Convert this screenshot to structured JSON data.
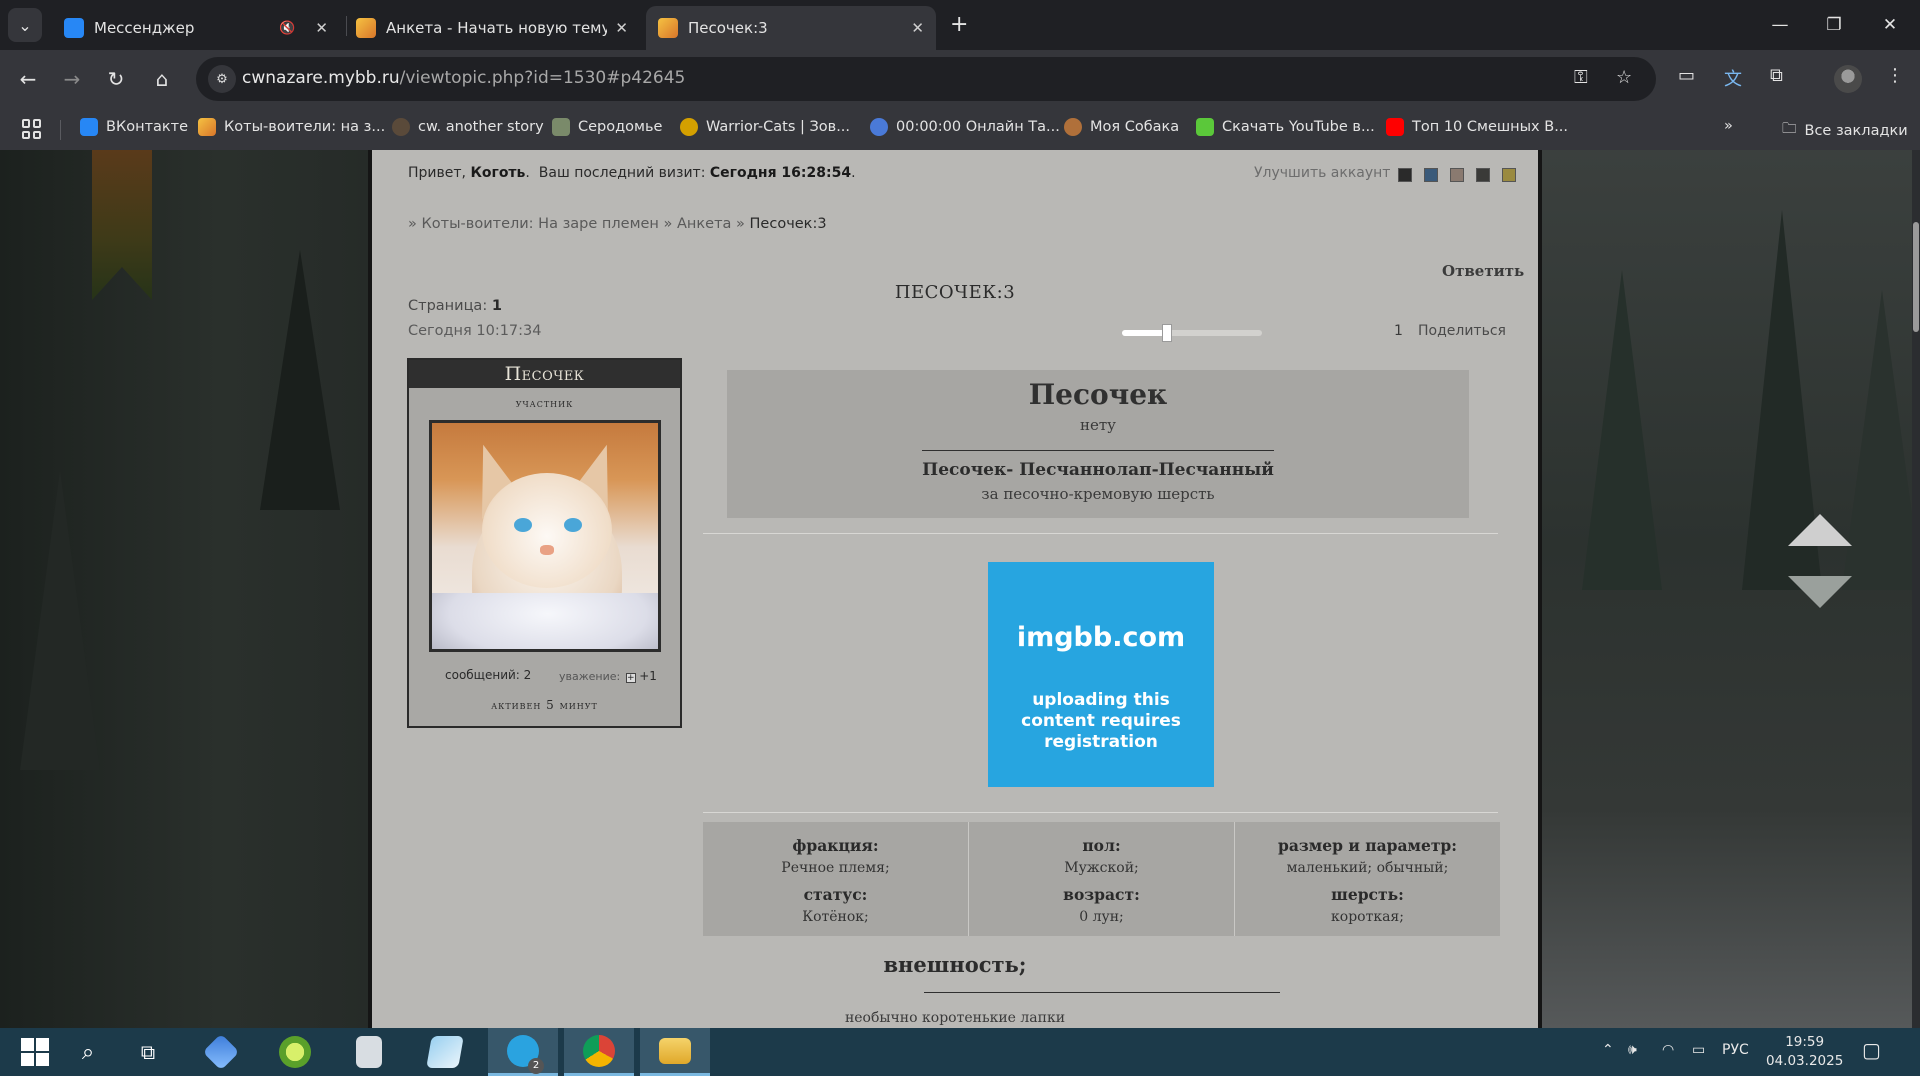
{
  "browser": {
    "tabs": [
      {
        "label": "Мессенджер",
        "active": false,
        "muted": true,
        "favicon_color": "#2787f5"
      },
      {
        "label": "Анкета - Начать новую тему",
        "active": false,
        "muted": false,
        "favicon_color": "#e8a42a"
      },
      {
        "label": "Песочек:3",
        "active": true,
        "muted": false,
        "favicon_color": "#e8a42a"
      }
    ],
    "url_host": "cwnazare.mybb.ru",
    "url_path": "/viewtopic.php?id=1530#p42645",
    "bookmarks": [
      {
        "label": "ВКонтакте",
        "color": "#2787f5"
      },
      {
        "label": "Коты-воители: на з...",
        "color": "#e8a42a"
      },
      {
        "label": "cw. another story",
        "color": "#5a4a3a"
      },
      {
        "label": "Серодомье",
        "color": "#7a8a6a"
      },
      {
        "label": "Warrior-Cats | Зов...",
        "color": "#d4a000"
      },
      {
        "label": "00:00:00 Онлайн Та...",
        "color": "#4a7ad8"
      },
      {
        "label": "Моя Собака",
        "color": "#b0703a"
      },
      {
        "label": "Скачать YouTube в...",
        "color": "#5bc83a"
      },
      {
        "label": "Топ 10 Смешных В...",
        "color": "#ff0000"
      }
    ],
    "all_bookmarks": "Все закладки"
  },
  "forum": {
    "greeting_prefix": "Привет,",
    "username": "Коготь",
    "last_visit_label": "Ваш последний визит:",
    "last_visit_value": "Сегодня 16:28:54",
    "upgrade": "Улучшить аккаунт",
    "style_swatches": [
      "#2a2a2a",
      "#3a5a7a",
      "#8a7a70",
      "#3a3a38",
      "#9a8a40"
    ],
    "breadcrumb": {
      "sep": "»",
      "forum": "Коты-воители: На заре племен",
      "section": "Анкета",
      "current": "Песочек:3"
    },
    "reply": "Ответить",
    "topic_title": "ПЕСОЧЕК:3",
    "pages_label": "Страница:",
    "pages_value": "1",
    "post_date": "Сегодня 10:17:34",
    "slider_level": 0.32,
    "post_number": "1",
    "share": "Поделиться"
  },
  "profile": {
    "name": "Песочек",
    "rank": "участник",
    "posts": "сообщений: 2",
    "respect_label": "уважение:",
    "respect_value": "+1",
    "activity": "активен 5 минут"
  },
  "post": {
    "title": "Песочек",
    "subtitle": "нету",
    "names": "Песочек- Песчаннолап-Песчанный",
    "names_desc": "за песочно-кремовую шерсть",
    "image_host": "imgbb.com",
    "image_message": "uploading this content requires registration",
    "info": [
      {
        "l1": "фракция:",
        "v1": "Речное племя;",
        "l2": "статус:",
        "v2": "Котёнок;"
      },
      {
        "l1": "пол:",
        "v1": "Мужской;",
        "l2": "возраст:",
        "v2": "0 лун;"
      },
      {
        "l1": "размер и параметр:",
        "v1": "маленький; обычный;",
        "l2": "шерсть:",
        "v2": "короткая;"
      }
    ],
    "looks_title": "внешность;",
    "looks_text": "необычно коротенькие лапки"
  },
  "taskbar": {
    "lang": "РУС",
    "time": "19:59",
    "date": "04.03.2025",
    "telegram_badge": "2"
  }
}
